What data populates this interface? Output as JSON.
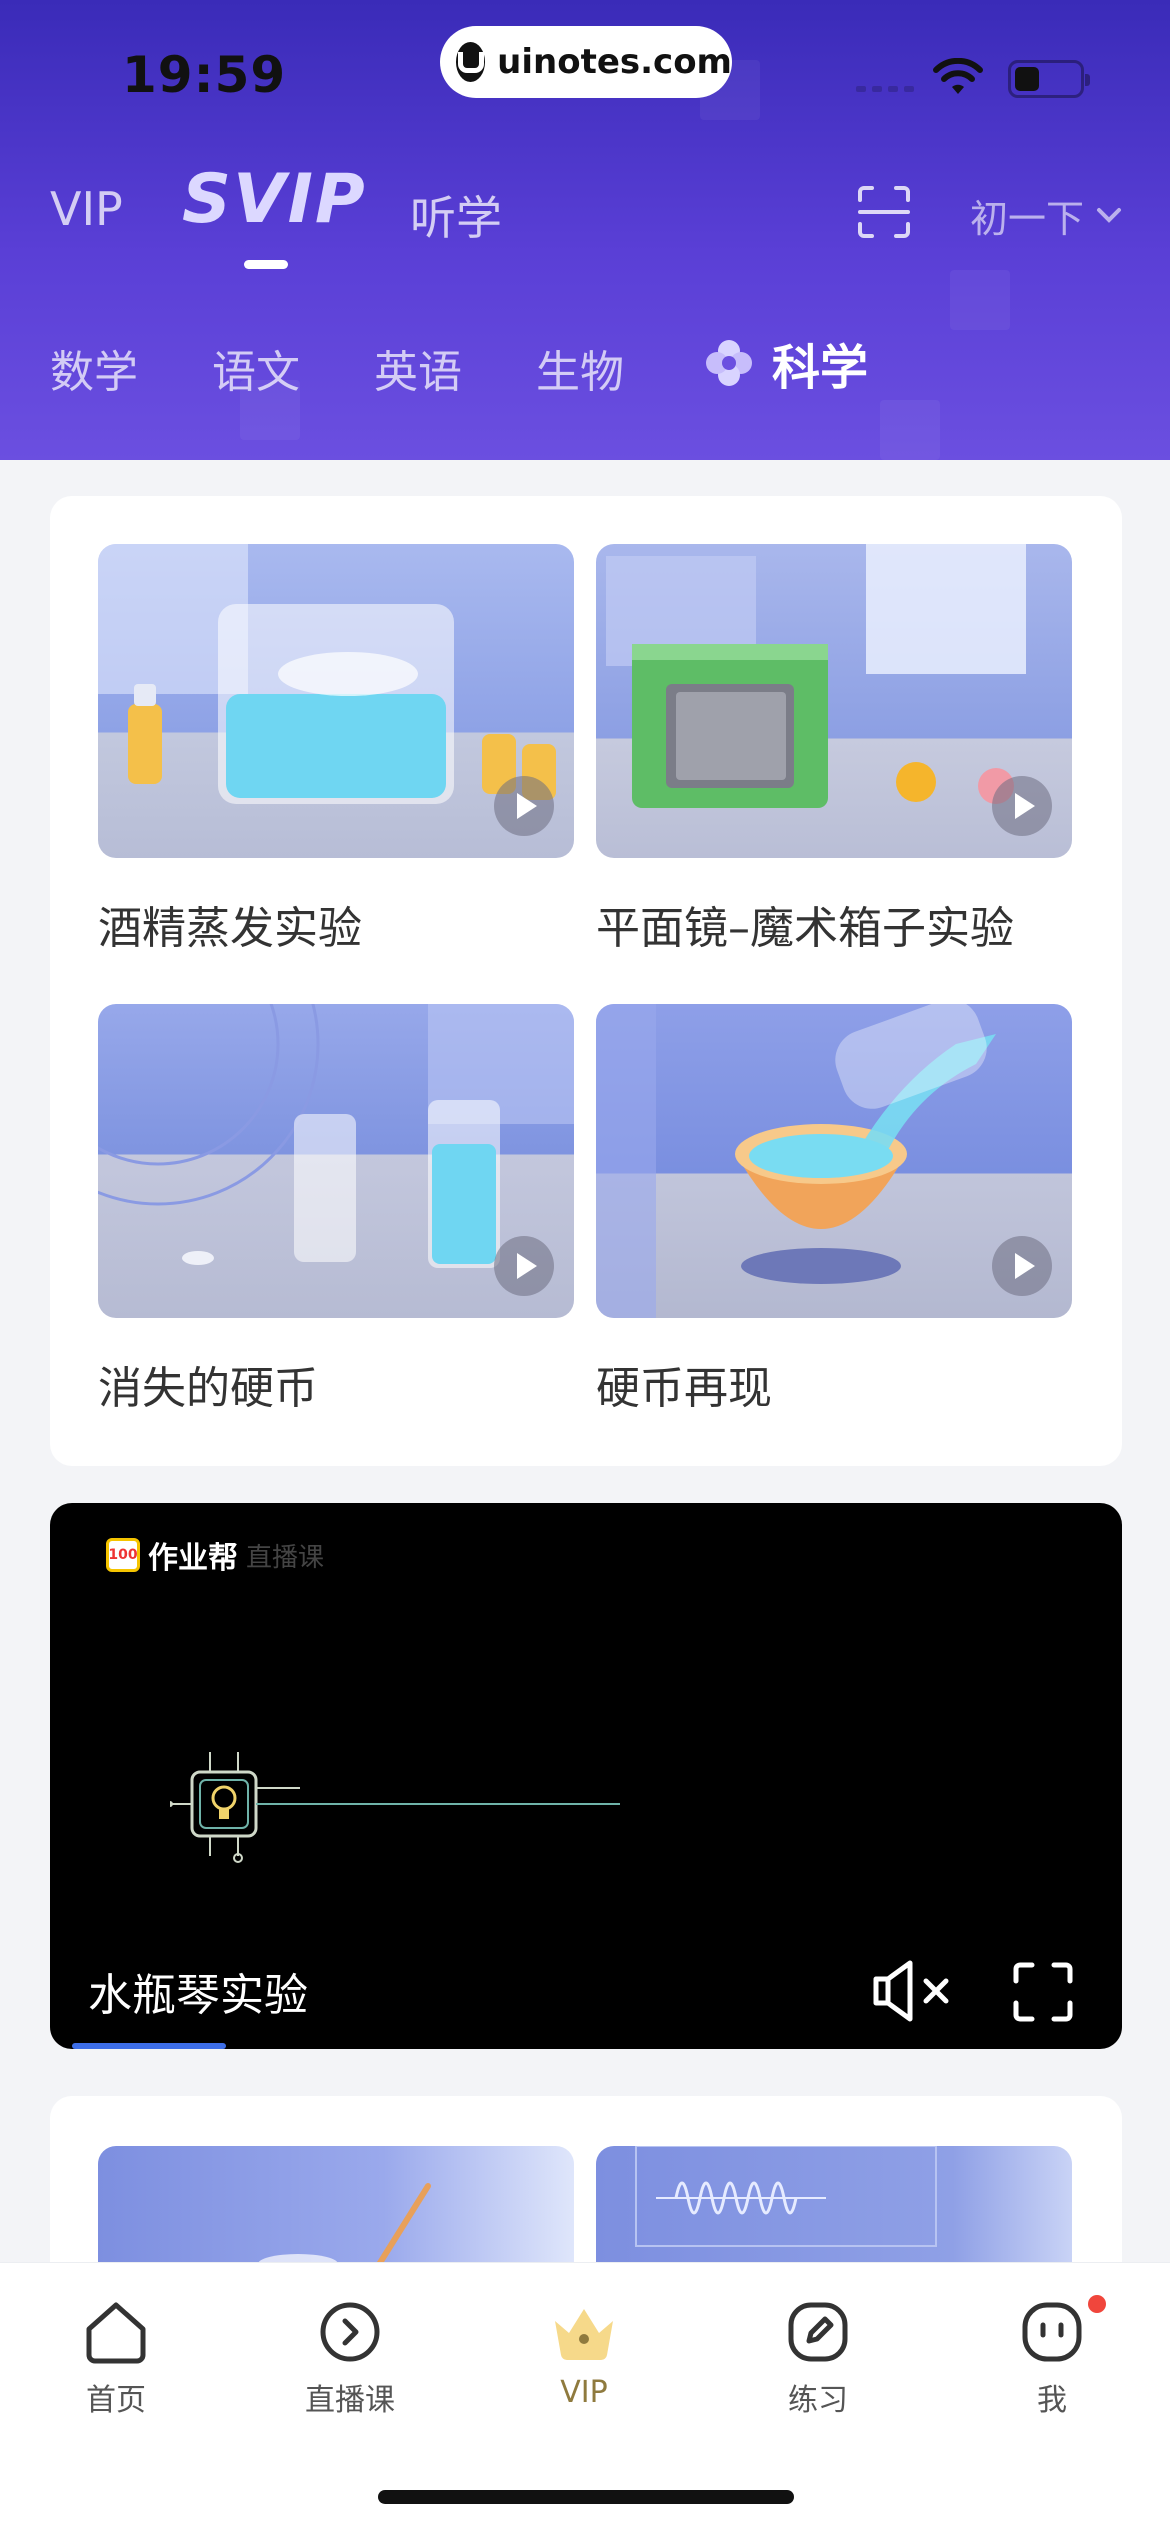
{
  "status_bar": {
    "time": "19:59",
    "url": "uinotes.com"
  },
  "top_tabs": {
    "vip": "VIP",
    "svip": "SVIP",
    "listen": "听学",
    "grade": "初一下"
  },
  "subjects": [
    "数学",
    "语文",
    "英语",
    "生物"
  ],
  "active_subject": "科学",
  "experiments": [
    {
      "title": "酒精蒸发实验"
    },
    {
      "title": "平面镜–魔术箱子实验"
    },
    {
      "title": "消失的硬币"
    },
    {
      "title": "硬币再现"
    }
  ],
  "player": {
    "brand": "作业帮",
    "brand_faded": "直播课",
    "badge": "100",
    "title": "水瓶琴实验",
    "progress_fraction": 0.15
  },
  "bottom_nav": {
    "home": "首页",
    "live": "直播课",
    "vip": "VIP",
    "practice": "练习",
    "me": "我"
  },
  "colors": {
    "header_top": "#3a2bb8",
    "header_bottom": "#6b4fe0",
    "vip_active": "#8f7a3e",
    "notification_dot": "#f0463c",
    "progress": "#3d6ee8"
  },
  "icons": [
    "scan-icon",
    "chevron-down-icon",
    "flower-icon",
    "play-icon",
    "mute-icon",
    "fullscreen-icon",
    "home-icon",
    "live-icon",
    "vip-crown-icon",
    "practice-icon",
    "me-icon"
  ]
}
